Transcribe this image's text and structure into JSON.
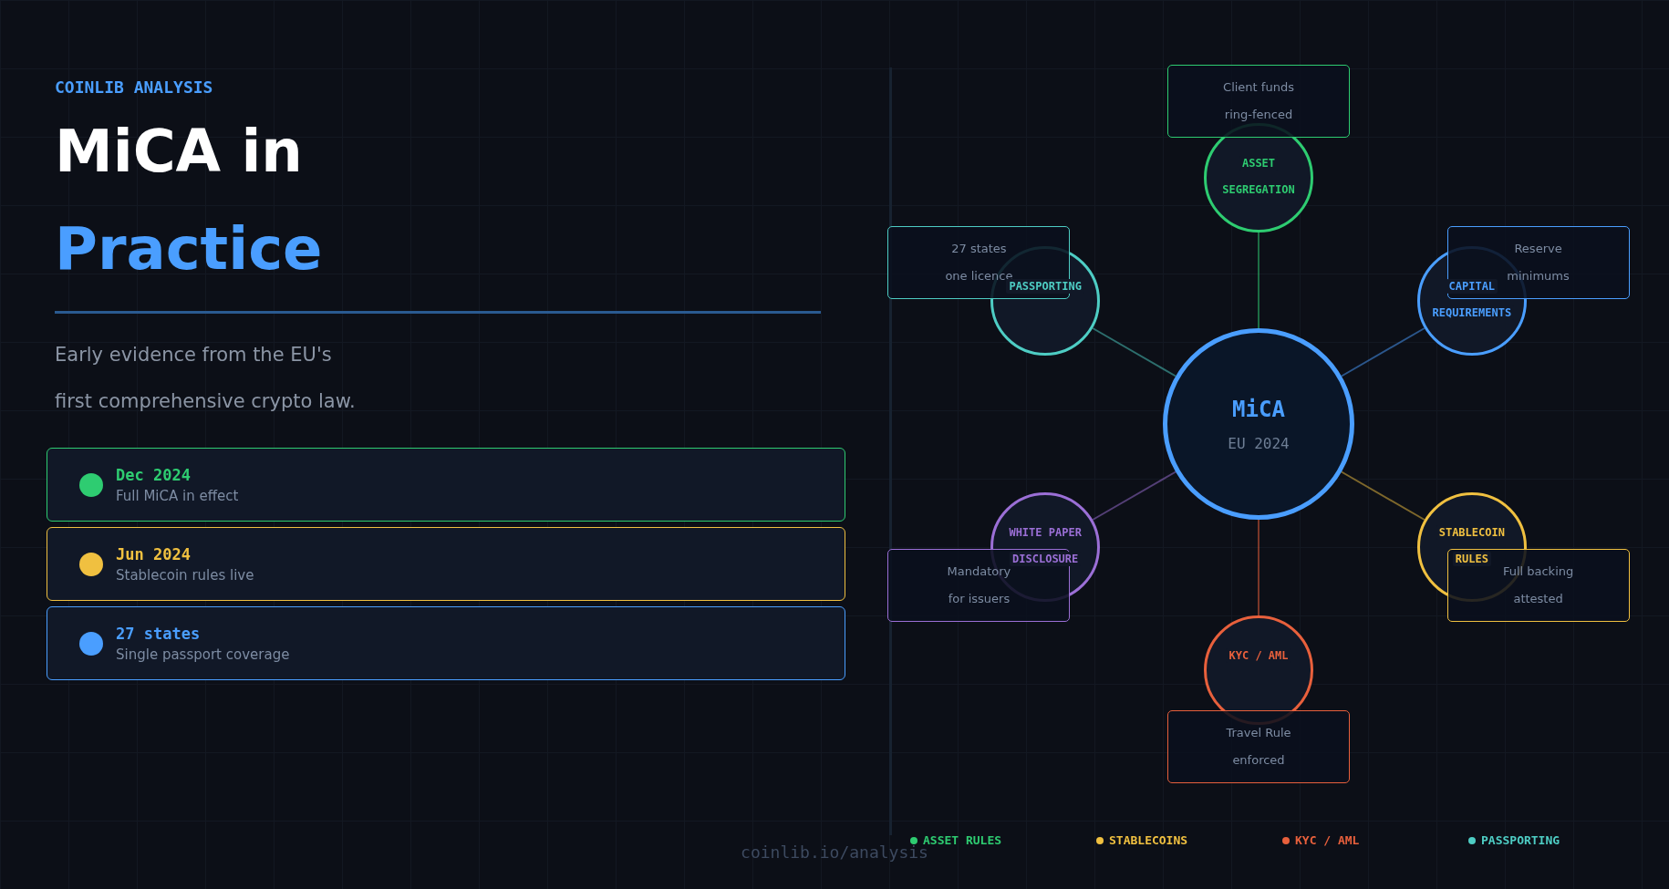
{
  "header": {
    "kicker": "COINLIB ANALYSIS",
    "title_line1": "MiCA in",
    "title_line2": "Practice",
    "subtitle_lines": [
      "Early evidence from the EU's",
      "first comprehensive crypto law."
    ]
  },
  "milestones": [
    {
      "date": "Dec 2024",
      "caption": "Full MiCA in effect",
      "color": "#2ecc71"
    },
    {
      "date": "Jun 2024",
      "caption": "Stablecoin rules live",
      "color": "#f0c040"
    },
    {
      "date": "27 states",
      "caption": "Single passport coverage",
      "color": "#4a9eff"
    }
  ],
  "diagram": {
    "center": {
      "title": "MiCA",
      "subtitle": "EU 2024"
    },
    "nodes": [
      {
        "label_lines": [
          "ASSET",
          "SEGREGATION"
        ],
        "note_lines": [
          "Client funds",
          "ring-fenced"
        ],
        "color": "#2ecc71"
      },
      {
        "label_lines": [
          "PASSPORTING"
        ],
        "note_lines": [
          "27 states",
          "one licence"
        ],
        "color": "#4ecdc4"
      },
      {
        "label_lines": [
          "CAPITAL",
          "REQUIREMENTS"
        ],
        "note_lines": [
          "Reserve",
          "minimums"
        ],
        "color": "#4a9eff"
      },
      {
        "label_lines": [
          "WHITE PAPER",
          "DISCLOSURE"
        ],
        "note_lines": [
          "Mandatory",
          "for issuers"
        ],
        "color": "#9b6fd6"
      },
      {
        "label_lines": [
          "STABLECOIN",
          "RULES"
        ],
        "note_lines": [
          "Full backing",
          "attested"
        ],
        "color": "#f0c040"
      },
      {
        "label_lines": [
          "KYC / AML"
        ],
        "note_lines": [
          "Travel Rule",
          "enforced"
        ],
        "color": "#e8603c"
      }
    ]
  },
  "legend": [
    {
      "label": "ASSET RULES",
      "color": "#2ecc71"
    },
    {
      "label": "STABLECOINS",
      "color": "#f0c040"
    },
    {
      "label": "KYC / AML",
      "color": "#e8603c"
    },
    {
      "label": "PASSPORTING",
      "color": "#4ecdc4"
    }
  ],
  "footer": "coinlib.io/analysis"
}
